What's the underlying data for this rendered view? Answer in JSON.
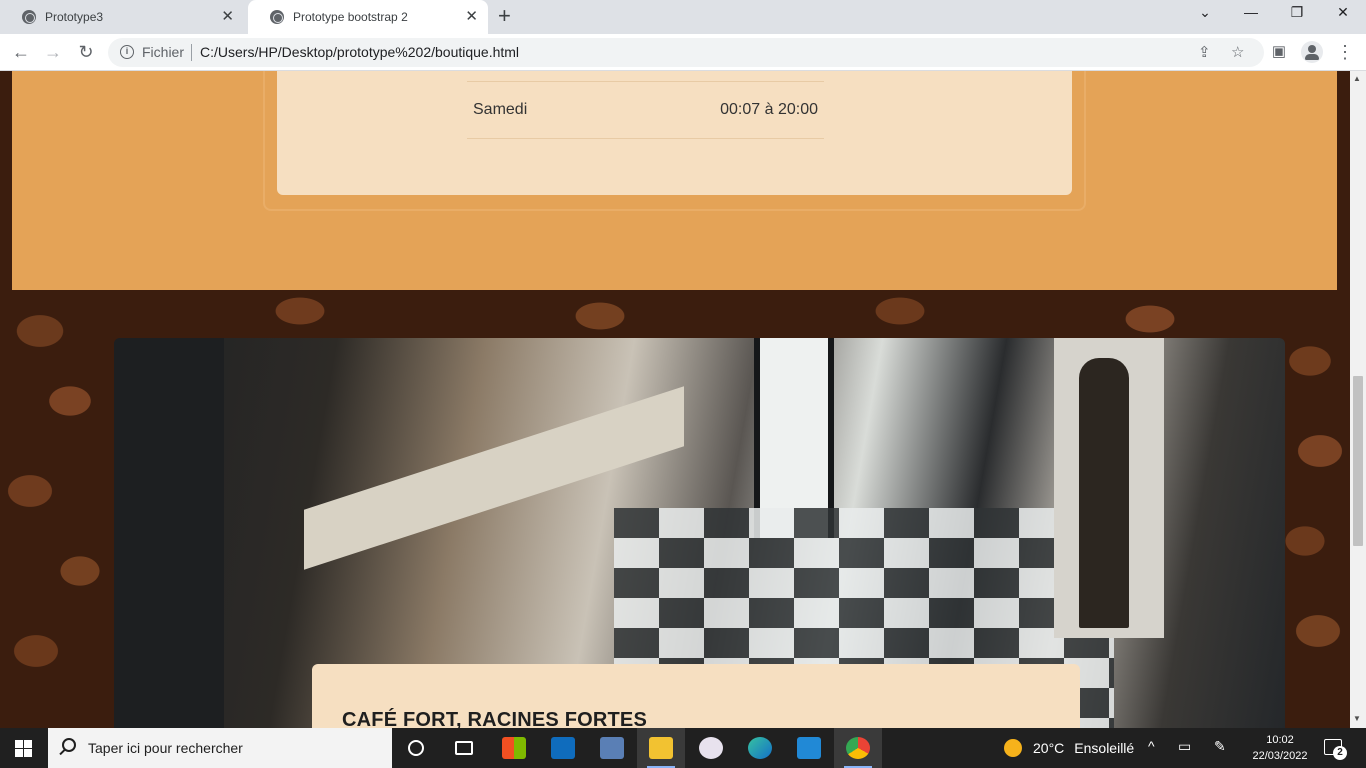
{
  "browser": {
    "tabs": [
      {
        "title": "Prototype3",
        "active": false
      },
      {
        "title": "Prototype bootstrap 2",
        "active": true
      }
    ],
    "new_tab_symbol": "+",
    "close_symbol": "✕",
    "site_label": "Fichier",
    "url": "C:/Users/HP/Desktop/prototype%202/boutique.html",
    "icons": {
      "back": "back-arrow-icon",
      "forward": "forward-arrow-icon",
      "reload": "reload-icon",
      "info": "info-icon",
      "share": "share-icon",
      "bookmark": "star-icon",
      "sidebar": "side-panel-icon",
      "profile": "profile-icon",
      "menu": "kebab-menu-icon"
    }
  },
  "page": {
    "hours": {
      "day": "Samedi",
      "time": "00:07 à 20:00"
    },
    "slogan": "CAFÉ FORT, RACINES FORTES",
    "colors": {
      "band": "#e4a357",
      "card": "#f6dfc1"
    }
  },
  "taskbar": {
    "search_placeholder": "Taper ici pour rechercher",
    "weather": {
      "temperature": "20°C",
      "condition": "Ensoleillé"
    },
    "time": "10:02",
    "date": "22/03/2022",
    "notification_count": "2"
  }
}
